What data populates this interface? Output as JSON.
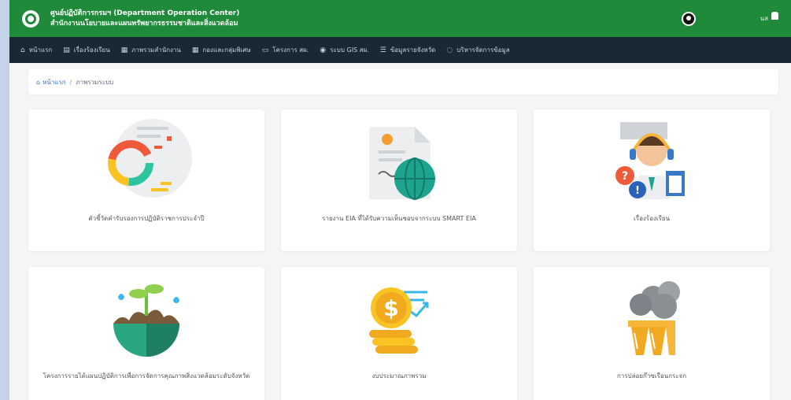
{
  "header": {
    "title_line1": "ศูนย์ปฏิบัติการกรมฯ (Department Operation Center)",
    "title_line2": "สำนักงานนโยบายและแผนทรัพยากรธรรมชาติและสิ่งแวดล้อม",
    "user": "นส"
  },
  "nav": {
    "items": [
      {
        "label": "หน้าแรก",
        "icon": "home-icon",
        "glyph": "⌂"
      },
      {
        "label": "เรื่องร้องเรียน",
        "icon": "chat-icon",
        "glyph": "▤"
      },
      {
        "label": "ภาพรวมสำนักงาน",
        "icon": "grid-icon",
        "glyph": "▦"
      },
      {
        "label": "กองและกลุ่มพิเศษ",
        "icon": "grid-icon",
        "glyph": "▦"
      },
      {
        "label": "โครงการ สผ.",
        "icon": "folder-icon",
        "glyph": "▭"
      },
      {
        "label": "ระบบ GIS สผ.",
        "icon": "map-pin-icon",
        "glyph": "◉"
      },
      {
        "label": "ข้อมูลรายจังหวัด",
        "icon": "list-icon",
        "glyph": "☰"
      },
      {
        "label": "บริหารจัดการข้อมูล",
        "icon": "settings-icon",
        "glyph": "◌"
      }
    ]
  },
  "breadcrumb": {
    "home": "หน้าแรก",
    "separator": "/",
    "current": "ภาพรวมระบบ"
  },
  "cards": [
    {
      "label": "ตัวชี้วัดคำรับรองการปฏิบัติราชการประจำปี",
      "icon": "donut-chart-icon"
    },
    {
      "label": "รายงาน EIA ที่ได้รับความเห็นชอบจากระบบ SMART EIA",
      "icon": "document-globe-icon"
    },
    {
      "label": "เรื่องร้องเรียน",
      "icon": "call-center-agent-icon"
    },
    {
      "label": "โครงการรายได้แผนปฏิบัติการเพื่อการจัดการคุณภาพสิ่งแวดล้อมระดับจังหวัด",
      "icon": "earth-plant-icon"
    },
    {
      "label": "งบประมาณภาพรวม",
      "icon": "coins-growth-icon"
    },
    {
      "label": "การปล่อยก๊าซเรือนกระจก",
      "icon": "factory-smoke-icon"
    }
  ],
  "colors": {
    "header_bg": "#1f8a3a",
    "nav_bg": "#1a2833",
    "page_bg": "#f4f5f7",
    "accent_blue": "#3a73c4"
  }
}
